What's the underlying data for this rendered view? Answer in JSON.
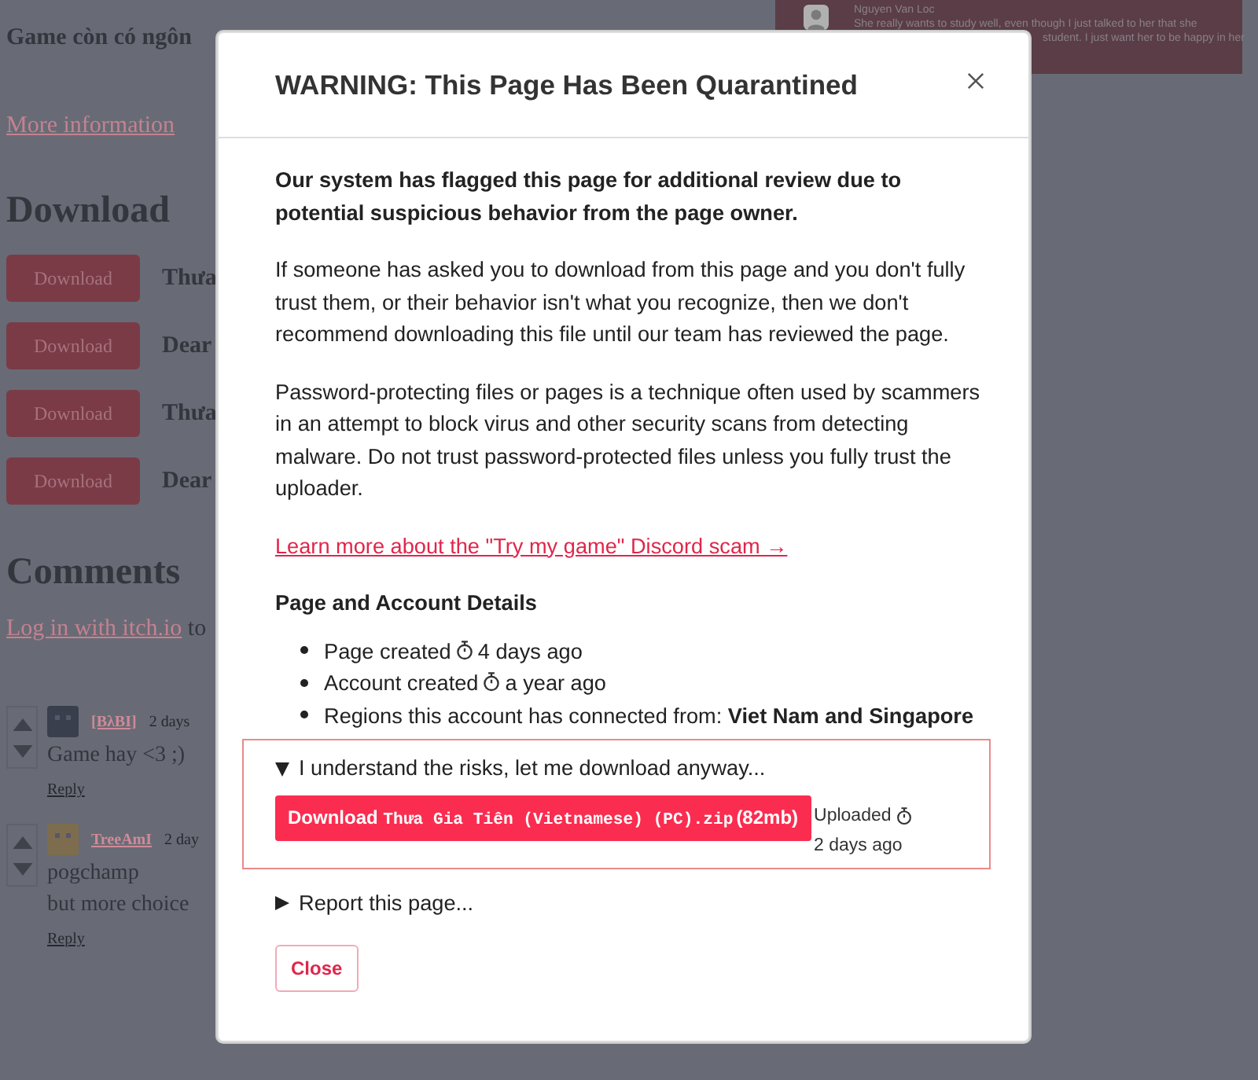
{
  "background": {
    "title_fragment": "Game còn có ngôn",
    "more_info_link": "More information",
    "download_heading": "Download",
    "downloads": [
      {
        "button": "Download",
        "name": "Thưa"
      },
      {
        "button": "Download",
        "name": "Dear"
      },
      {
        "button": "Download",
        "name": "Thưa"
      },
      {
        "button": "Download",
        "name": "Dear"
      }
    ],
    "comments_heading": "Comments",
    "login_link": "Log in with itch.io",
    "login_suffix": "to",
    "comments": [
      {
        "author": "[BλBI]",
        "time": "2 days",
        "lines": [
          "Game hay <3 ;)"
        ],
        "reply": "Reply"
      },
      {
        "author": "TreeAmI",
        "time": "2 day",
        "lines": [
          "pogchamp",
          "but more choice"
        ],
        "reply": "Reply"
      }
    ],
    "featured_comment": {
      "author": "Nguyen Van Loc",
      "lines": [
        "She really wants to study well, even though I just talked to her that she",
        "student. I just want her to be happy in her"
      ]
    }
  },
  "modal": {
    "title": "WARNING: This Page Has Been Quarantined",
    "lead": "Our system has flagged this page for additional review due to potential suspicious behavior from the page owner.",
    "paragraphs": [
      "If someone has asked you to download from this page and you don't fully trust them, or their behavior isn't what you recognize, then we don't recommend downloading this file until our team has reviewed the page.",
      "Password-protecting files or pages is a technique often used by scammers in an attempt to block virus and other security scans from detecting malware. Do not trust password-protected files unless you fully trust the uploader."
    ],
    "link": "Learn more about the \"Try my game\" Discord scam →",
    "details_heading": "Page and Account Details",
    "details": [
      {
        "text": "Page created",
        "time": "4 days ago"
      },
      {
        "text": "Account created",
        "time": "a year ago"
      },
      {
        "text": "Regions this account has connected from: **Viet Nam and Singapore**"
      }
    ],
    "risk": {
      "summary": "I understand the risks, let me download anyway...",
      "expanded": true,
      "download_label": "Download",
      "filename": "Thưa Gia Tiên (Vietnamese) (PC).zip",
      "size": "(82mb)",
      "uploaded": "Uploaded",
      "uploaded_time": "2 days ago"
    },
    "report": {
      "summary": "Report this page...",
      "expanded": false
    },
    "close_button": "Close"
  }
}
